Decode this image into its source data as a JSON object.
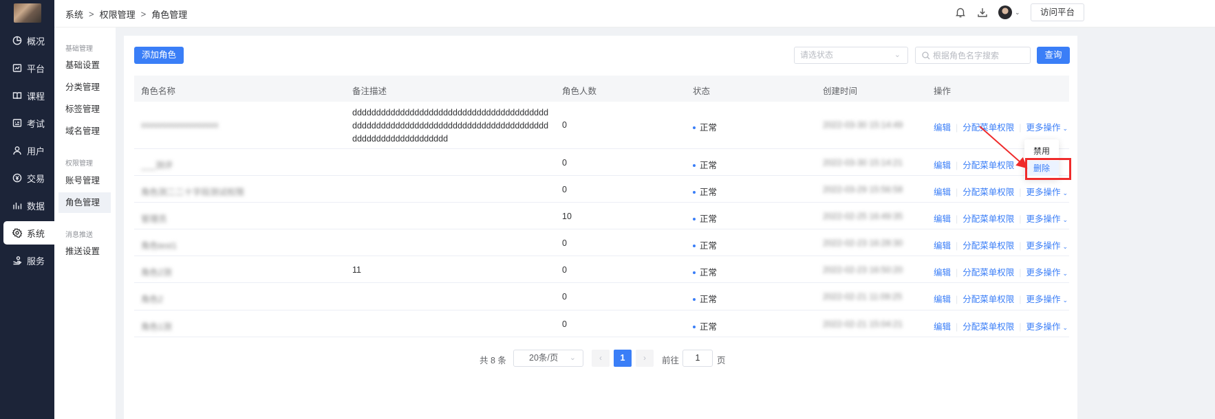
{
  "breadcrumb": [
    "系统",
    "权限管理",
    "角色管理"
  ],
  "header": {
    "visit_label": "访问平台"
  },
  "sidebar": {
    "items": [
      {
        "label": "概况",
        "icon": "dashboard-icon"
      },
      {
        "label": "平台",
        "icon": "platform-icon"
      },
      {
        "label": "课程",
        "icon": "book-icon"
      },
      {
        "label": "考试",
        "icon": "exam-icon"
      },
      {
        "label": "用户",
        "icon": "user-icon"
      },
      {
        "label": "交易",
        "icon": "transaction-icon"
      },
      {
        "label": "数据",
        "icon": "chart-icon"
      },
      {
        "label": "系统",
        "icon": "gear-icon",
        "active": true
      },
      {
        "label": "服务",
        "icon": "service-icon"
      }
    ]
  },
  "submenu": {
    "groups": [
      {
        "title": "基础管理",
        "items": [
          "基础设置",
          "分类管理",
          "标签管理",
          "域名管理"
        ]
      },
      {
        "title": "权限管理",
        "items": [
          "账号管理",
          "角色管理"
        ]
      },
      {
        "title": "消息推送",
        "items": [
          "推送设置"
        ]
      }
    ],
    "active": "角色管理"
  },
  "toolbar": {
    "add_label": "添加角色",
    "status_placeholder": "请选状态",
    "search_placeholder": "根据角色名字搜索",
    "query_label": "查询"
  },
  "table": {
    "headers": [
      "角色名称",
      "备注描述",
      "角色人数",
      "状态",
      "创建时间",
      "操作"
    ],
    "rows": [
      {
        "name": "xxxxxxxxxxxxxxxxxx",
        "desc": "dddddddddddddddddddddddddddddddddddddddddddddddddddddddddddddddddddddddddddddddddddddddddddddddddddddd",
        "count": "0",
        "status": "正常",
        "time": "2022-03-30 15:14:49"
      },
      {
        "name": "___测评",
        "desc": "",
        "count": "0",
        "status": "正常",
        "time": "2022-03-30 15:14:21"
      },
      {
        "name": "角色测二二十字段测试权限",
        "desc": "",
        "count": "0",
        "status": "正常",
        "time": "2022-03-29 15:56:58"
      },
      {
        "name": "管理员",
        "desc": "",
        "count": "10",
        "status": "正常",
        "time": "2022-02-25 16:49:35"
      },
      {
        "name": "角色test1",
        "desc": "",
        "count": "0",
        "status": "正常",
        "time": "2022-02-23 16:28:30"
      },
      {
        "name": "角色2测",
        "desc": "11",
        "count": "0",
        "status": "正常",
        "time": "2022-02-23 16:50:20"
      },
      {
        "name": "角色2",
        "desc": "",
        "count": "0",
        "status": "正常",
        "time": "2022-02-21 11:09:25"
      },
      {
        "name": "角色1测",
        "desc": "",
        "count": "0",
        "status": "正常",
        "time": "2022-02-21 15:04:21"
      }
    ],
    "row_actions": {
      "edit": "编辑",
      "assign": "分配菜单权限",
      "more": "更多操作"
    }
  },
  "dropdown": {
    "items": [
      "禁用",
      "删除"
    ],
    "highlighted": "删除"
  },
  "pagination": {
    "total_text": "共 8 条",
    "page_size": "20条/页",
    "current_page": "1",
    "goto_label": "前往",
    "goto_value": "1",
    "page_unit": "页"
  },
  "colors": {
    "sidebar_bg": "#1c2438",
    "primary": "#3a7ef7",
    "highlight_box": "#ef2b2b"
  }
}
